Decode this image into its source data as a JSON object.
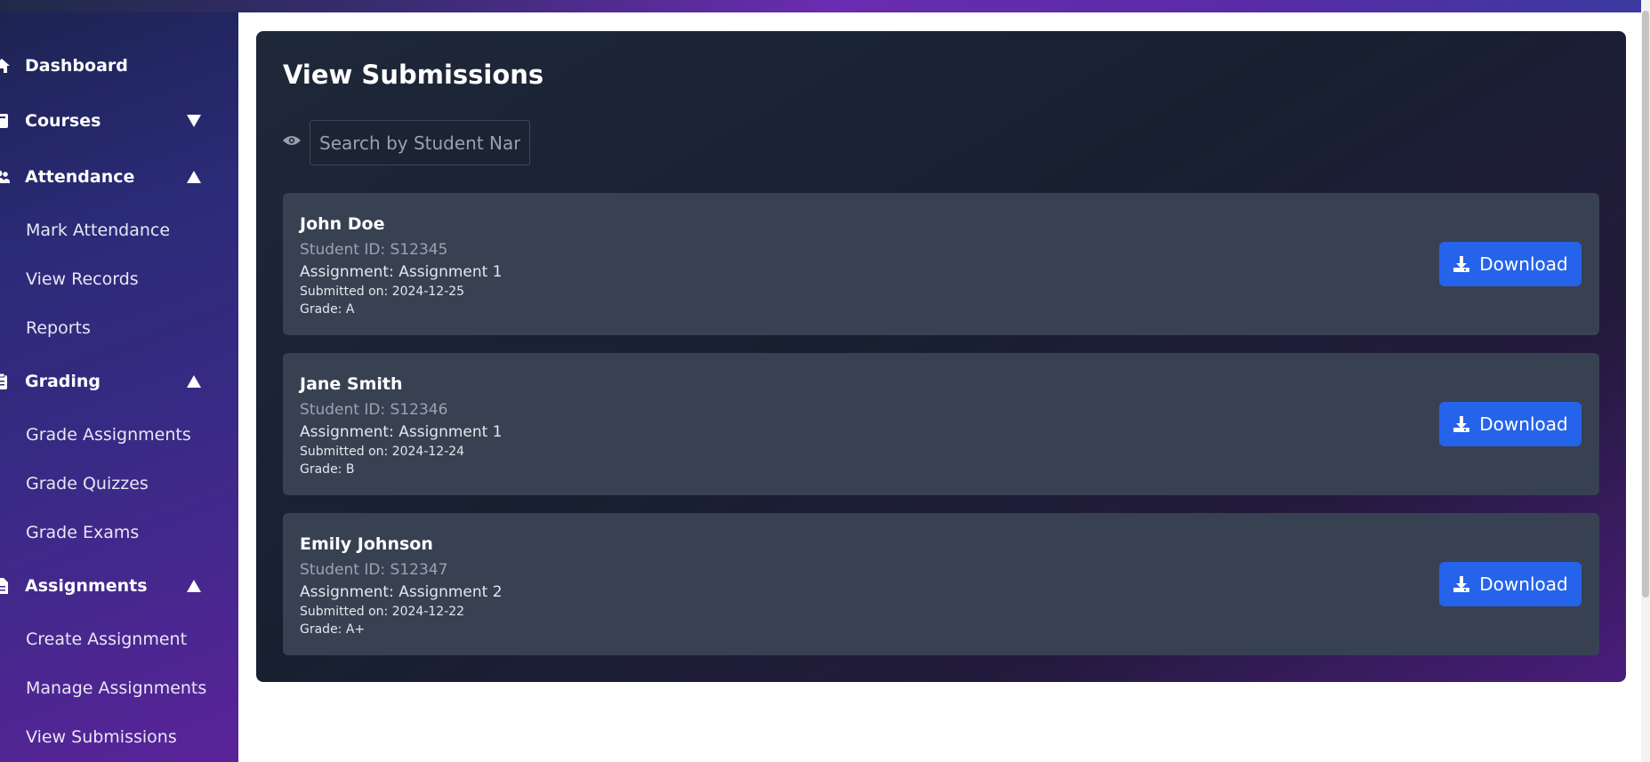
{
  "sidebar": {
    "sections": [
      {
        "label": "Dashboard",
        "icon": "home-icon",
        "caret": "none"
      },
      {
        "label": "Courses",
        "icon": "book-icon",
        "caret": "down"
      },
      {
        "label": "Attendance",
        "icon": "users-icon",
        "caret": "up"
      },
      {
        "label": "Grading",
        "icon": "clipboard-icon",
        "caret": "up"
      },
      {
        "label": "Assignments",
        "icon": "file-icon",
        "caret": "up"
      }
    ],
    "attendance_items": [
      "Mark Attendance",
      "View Records",
      "Reports"
    ],
    "grading_items": [
      "Grade Assignments",
      "Grade Quizzes",
      "Grade Exams"
    ],
    "assignments_items": [
      "Create Assignment",
      "Manage Assignments",
      "View Submissions"
    ]
  },
  "main": {
    "title": "View Submissions",
    "search": {
      "placeholder": "Search by Student Name",
      "value": ""
    },
    "submissions": [
      {
        "name": "John Doe",
        "student_id": "Student ID: S12345",
        "assignment": "Assignment: Assignment 1",
        "submitted": "Submitted on: 2024-12-25",
        "grade": "Grade: A",
        "button": "Download"
      },
      {
        "name": "Jane Smith",
        "student_id": "Student ID: S12346",
        "assignment": "Assignment: Assignment 1",
        "submitted": "Submitted on: 2024-12-24",
        "grade": "Grade: B",
        "button": "Download"
      },
      {
        "name": "Emily Johnson",
        "student_id": "Student ID: S12347",
        "assignment": "Assignment: Assignment 2",
        "submitted": "Submitted on: 2024-12-22",
        "grade": "Grade: A+",
        "button": "Download"
      }
    ]
  },
  "colors": {
    "accent": "#2563eb",
    "card": "#384152",
    "panel": "#172030"
  }
}
